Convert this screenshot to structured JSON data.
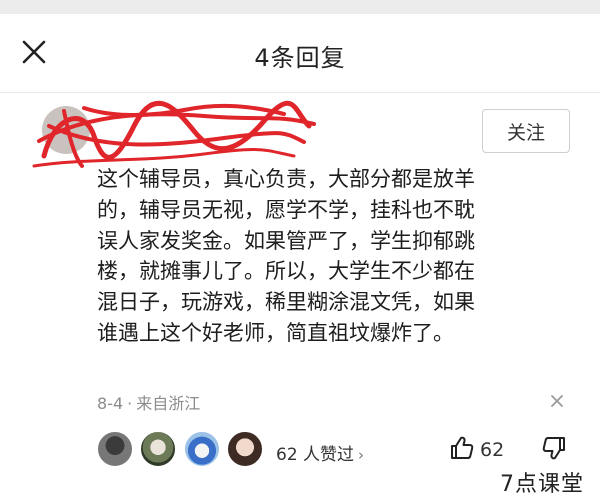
{
  "header": {
    "title": "4条回复",
    "close_icon": "close-icon"
  },
  "author": {
    "name": "",
    "meta": "",
    "follow_label": "关注"
  },
  "comment": {
    "lines": [
      "这个辅导员，真心负责，大部分都是放羊",
      "的，辅导员无视，愿学不学，挂科也不耽",
      "误人家发奖金。如果管严了，学生抑郁跳",
      "楼，就摊事儿了。所以，大学生不少都在",
      "混日子，玩游戏，稀里糊涂混文凭，如果",
      "谁遇上这个好老师，简直祖坟爆炸了。"
    ]
  },
  "meta": {
    "date": "8-4",
    "separator": "·",
    "location": "来自浙江"
  },
  "likes": {
    "summary": "62 人赞过",
    "chevron": "›",
    "count": "62"
  },
  "watermark": "7点课堂",
  "colors": {
    "scribble": "#e0262b",
    "text": "#1e1e1e",
    "muted": "#8c8c8c"
  }
}
